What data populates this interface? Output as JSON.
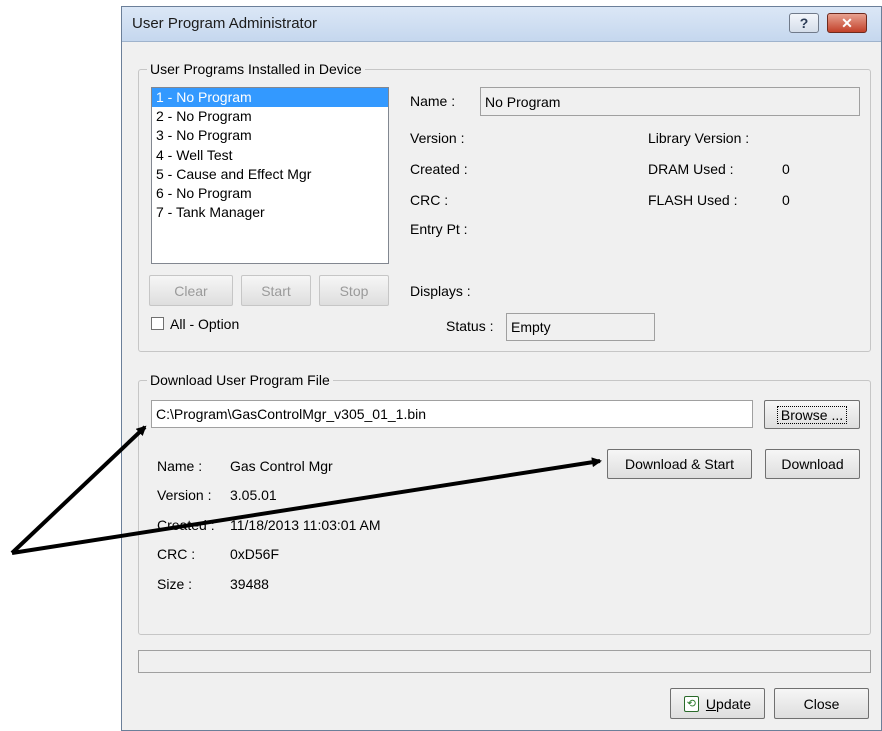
{
  "window": {
    "title": "User Program Administrator",
    "help_glyph": "?",
    "close_glyph": "✕"
  },
  "installed": {
    "group_label": "User Programs Installed in Device",
    "programs": [
      "1 - No Program",
      "2 - No Program",
      "3 - No Program",
      "4 - Well Test",
      "5 - Cause and Effect Mgr",
      "6 - No Program",
      "7 - Tank Manager"
    ],
    "selected_index": 0,
    "buttons": {
      "clear": "Clear",
      "start": "Start",
      "stop": "Stop"
    },
    "all_option_label": "All - Option",
    "all_option_checked": false,
    "details": {
      "name_label": "Name :",
      "name_value": "No Program",
      "version_label": "Version :",
      "created_label": "Created :",
      "crc_label": "CRC :",
      "entry_pt_label": "Entry Pt :",
      "displays_label": "Displays :",
      "library_version_label": "Library Version :",
      "dram_used_label": "DRAM Used :",
      "dram_used_value": "0",
      "flash_used_label": "FLASH Used :",
      "flash_used_value": "0",
      "status_label": "Status :",
      "status_value": "Empty"
    }
  },
  "download": {
    "group_label": "Download User Program File",
    "file_path": "C:\\Program\\GasControlMgr_v305_01_1.bin",
    "browse_label": "Browse ...",
    "download_start_label": "Download & Start",
    "download_label": "Download",
    "name_label": "Name :",
    "name_value": "Gas Control Mgr",
    "version_label": "Version :",
    "version_value": "3.05.01",
    "created_label": "Created :",
    "created_value": "11/18/2013 11:03:01 AM",
    "crc_label": "CRC :",
    "crc_value": "0xD56F",
    "size_label": "Size :",
    "size_value": "39488"
  },
  "progress": {
    "fraction": 0
  },
  "footer": {
    "update_mnemonic": "U",
    "update_rest": "pdate",
    "update_icon_glyph": "⟲",
    "close_label": "Close"
  },
  "colors": {
    "selection": "#3399ff",
    "dialog_bg": "#f0f0f0",
    "close_button": "#c2412a"
  }
}
